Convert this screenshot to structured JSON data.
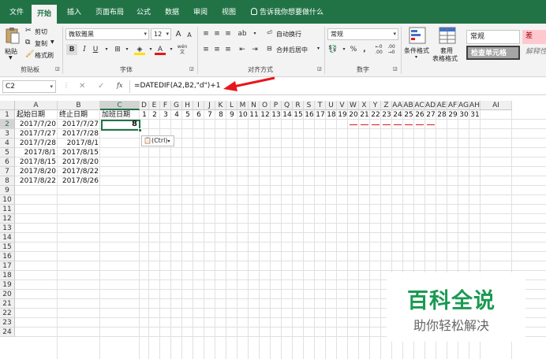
{
  "ribbon_tabs": [
    "文件",
    "开始",
    "插入",
    "页面布局",
    "公式",
    "数据",
    "审阅",
    "视图"
  ],
  "active_tab": "开始",
  "tell_me": "告诉我你想要做什么",
  "clipboard": {
    "paste": "粘贴",
    "cut": "剪切",
    "copy": "复制",
    "format_painter": "格式刷",
    "label": "剪贴板"
  },
  "font": {
    "name": "微软雅黑",
    "size": "12",
    "grow": "A",
    "shrink": "A",
    "bold": "B",
    "italic": "I",
    "underline": "U",
    "label": "字体",
    "wen": "wén"
  },
  "alignment": {
    "wrap": "自动换行",
    "merge": "合并后居中",
    "label": "对齐方式"
  },
  "number": {
    "format": "常规",
    "percent": "%",
    "comma": ",",
    "label": "数字"
  },
  "styles": {
    "conditional": "条件格式",
    "table_format_1": "套用",
    "table_format_2": "表格格式",
    "normal": "常规",
    "bad": "差",
    "check_cell": "检查单元格",
    "explanatory": "解释性"
  },
  "formula_bar": {
    "name_box": "C2",
    "cancel": "✕",
    "enter": "✓",
    "fx": "fx",
    "formula": "=DATEDIF(A2,B2,\"d\")+1"
  },
  "columns": [
    "A",
    "B",
    "C",
    "D",
    "E",
    "F",
    "G",
    "H",
    "I",
    "J",
    "K",
    "L",
    "M",
    "N",
    "O",
    "P",
    "Q",
    "R",
    "S",
    "T",
    "U",
    "V",
    "W",
    "X",
    "Y",
    "Z",
    "AA",
    "AB",
    "AC",
    "AD",
    "AE",
    "AF",
    "AG",
    "AH",
    "AI"
  ],
  "rows": [
    "1",
    "2",
    "3",
    "4",
    "5",
    "6",
    "7",
    "8",
    "9",
    "10",
    "11",
    "12",
    "13",
    "14",
    "15",
    "16",
    "17",
    "18",
    "19",
    "20",
    "21",
    "22",
    "23",
    "24"
  ],
  "headers": {
    "a": "起始日期",
    "b": "终止日期",
    "c": "加班日期"
  },
  "day_numbers": [
    "1",
    "2",
    "3",
    "4",
    "5",
    "6",
    "7",
    "8",
    "9",
    "10",
    "11",
    "12",
    "13",
    "14",
    "15",
    "16",
    "17",
    "18",
    "19",
    "20",
    "21",
    "22",
    "23",
    "24",
    "25",
    "26",
    "27",
    "28",
    "29",
    "30",
    "31"
  ],
  "data_rows": [
    {
      "start": "2017/7/20",
      "end": "2017/7/27",
      "days": "8"
    },
    {
      "start": "2017/7/27",
      "end": "2017/7/28",
      "days": ""
    },
    {
      "start": "2017/7/28",
      "end": "2017/8/1",
      "days": ""
    },
    {
      "start": "2017/8/1",
      "end": "2017/8/15",
      "days": ""
    },
    {
      "start": "2017/8/15",
      "end": "2017/8/20",
      "days": ""
    },
    {
      "start": "2017/8/20",
      "end": "2017/8/22",
      "days": ""
    },
    {
      "start": "2017/8/22",
      "end": "2017/8/26",
      "days": ""
    }
  ],
  "paste_options": "(Ctrl)",
  "watermark": {
    "title": "百科全说",
    "subtitle": "助你轻松解决"
  },
  "colors": {
    "excel_green": "#217346",
    "arrow_red": "#e8161b",
    "watermark_green": "#1a9a52",
    "bad_fill": "#ffc7ce",
    "check_fill": "#a5a5a5"
  }
}
